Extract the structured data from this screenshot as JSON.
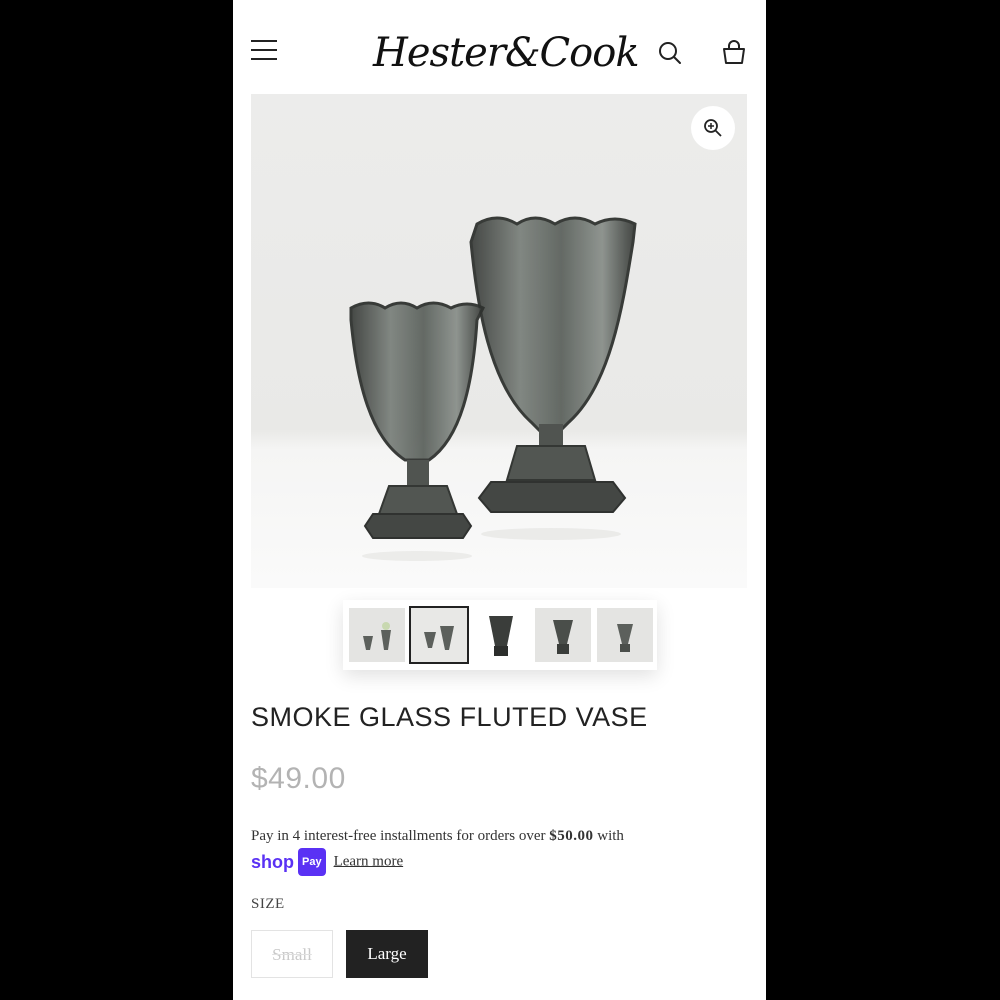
{
  "header": {
    "logo_text": "Hester&Cook",
    "menu_icon": "hamburger-menu-icon",
    "search_icon": "search-icon",
    "cart_icon": "shopping-bag-icon"
  },
  "gallery": {
    "zoom_icon": "zoom-in-icon",
    "thumbnail_count": 5,
    "selected_thumbnail": 2
  },
  "product": {
    "title": "SMOKE GLASS FLUTED VASE",
    "price": "$49.00"
  },
  "installments": {
    "text": "Pay in 4 interest-free installments for orders over",
    "threshold": "$50.00",
    "suffix": "with",
    "shop_label": "shop",
    "pay_label": "Pay",
    "learn_more": "Learn more"
  },
  "size": {
    "label": "SIZE",
    "options": [
      "Small",
      "Large"
    ],
    "selected": "Large",
    "unavailable": "Small"
  },
  "colors": {
    "background": "#000000",
    "text": "#222222",
    "price": "#b3b3b3",
    "shop_pay": "#5a31f4",
    "selected_button": "#222222"
  }
}
